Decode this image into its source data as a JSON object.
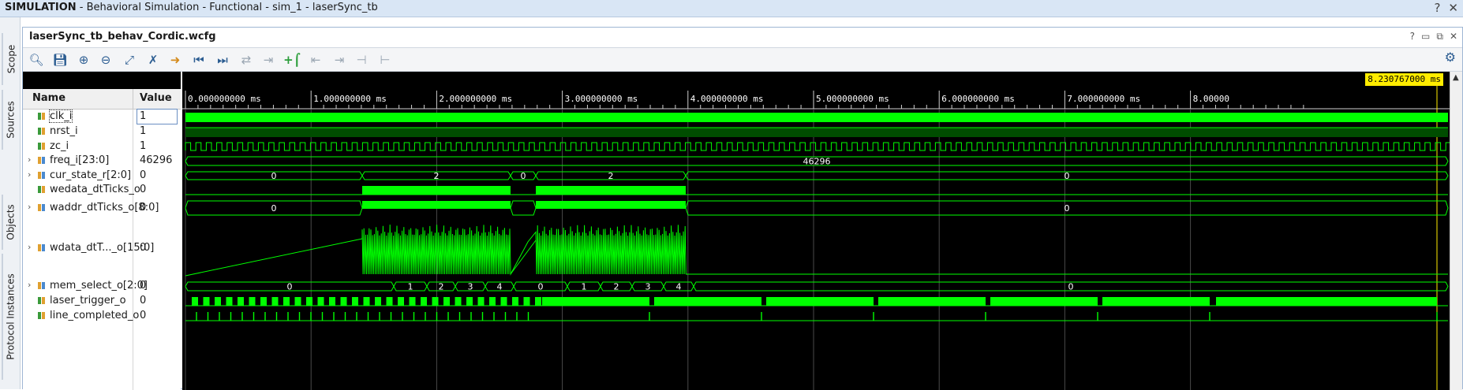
{
  "window": {
    "title_bold": "SIMULATION",
    "title_rest": " - Behavioral Simulation - Functional - sim_1 - laserSync_tb",
    "help_icon": "?",
    "close_icon": "✕"
  },
  "side_tabs": [
    "Scope",
    "Sources",
    "Objects",
    "Protocol Instances"
  ],
  "document": {
    "title": "laserSync_tb_behav_Cordic.wcfg",
    "controls": [
      "?",
      "▭",
      "⧉",
      "✕"
    ]
  },
  "toolbar": {
    "buttons": [
      {
        "name": "search-icon",
        "glyph": "🔍︎",
        "enabled": true
      },
      {
        "name": "save-icon",
        "glyph": "💾︎",
        "enabled": true
      },
      {
        "name": "zoom-in-icon",
        "glyph": "⊕",
        "enabled": true
      },
      {
        "name": "zoom-out-icon",
        "glyph": "⊖",
        "enabled": true
      },
      {
        "name": "zoom-fit-icon",
        "glyph": "⤢",
        "enabled": true
      },
      {
        "name": "cursor-to-zero-icon",
        "glyph": "✗",
        "enabled": true
      },
      {
        "name": "go-to-cursor-icon",
        "glyph": "➜",
        "enabled": true
      },
      {
        "name": "go-to-start-icon",
        "glyph": "⏮",
        "enabled": true
      },
      {
        "name": "go-to-end-icon",
        "glyph": "⏭",
        "enabled": true
      },
      {
        "name": "swap-cursors-icon",
        "glyph": "⇄",
        "enabled": false
      },
      {
        "name": "snap-icon",
        "glyph": "⇥",
        "enabled": false
      },
      {
        "name": "add-marker-icon",
        "glyph": "+⌠",
        "enabled": true
      },
      {
        "name": "prev-marker-icon",
        "glyph": "⇤",
        "enabled": false
      },
      {
        "name": "next-marker-icon",
        "glyph": "⇥",
        "enabled": false
      },
      {
        "name": "prev-transition-icon",
        "glyph": "⊣",
        "enabled": false
      },
      {
        "name": "next-transition-icon",
        "glyph": "⊢",
        "enabled": false
      }
    ],
    "settings_icon": "⚙"
  },
  "columns": {
    "name": "Name",
    "value": "Value"
  },
  "signals": [
    {
      "name": "clk_i",
      "value": "1",
      "bus": false
    },
    {
      "name": "nrst_i",
      "value": "1",
      "bus": false
    },
    {
      "name": "zc_i",
      "value": "1",
      "bus": false
    },
    {
      "name": "freq_i[23:0]",
      "value": "46296",
      "bus": true
    },
    {
      "name": "cur_state_r[2:0]",
      "value": "0",
      "bus": true
    },
    {
      "name": "wedata_dtTicks_o",
      "value": "0",
      "bus": false
    },
    {
      "name": "waddr_dtTicks_o[8:0]",
      "value": "0",
      "bus": true
    },
    {
      "name": "wdata_dtT..._o[15:0]",
      "value": "0",
      "bus": true
    },
    {
      "name": "mem_select_o[2:0]",
      "value": "0",
      "bus": true
    },
    {
      "name": "laser_trigger_o",
      "value": "0",
      "bus": false
    },
    {
      "name": "line_completed_o",
      "value": "0",
      "bus": false
    }
  ],
  "timeline": {
    "cursor_label": "8.230767000 ms",
    "ticks": [
      "0.000000000 ms",
      "1.000000000 ms",
      "2.000000000 ms",
      "3.000000000 ms",
      "4.000000000 ms",
      "5.000000000 ms",
      "6.000000000 ms",
      "7.000000000 ms",
      "8.00000"
    ]
  },
  "waves": {
    "freq_label": "46296",
    "cur_state_segments": [
      "0",
      "2",
      "0",
      "2",
      "0"
    ],
    "waddr_segments": [
      "0",
      "0",
      "0"
    ],
    "mem_select_segments": [
      "0",
      "1",
      "2",
      "3",
      "4",
      "0",
      "1",
      "2",
      "3",
      "4",
      "0"
    ]
  },
  "colors": {
    "wave": "#00ff00",
    "wave_dark": "#00a000",
    "cursor": "#ffec00",
    "grid": "#4a4a4a"
  }
}
